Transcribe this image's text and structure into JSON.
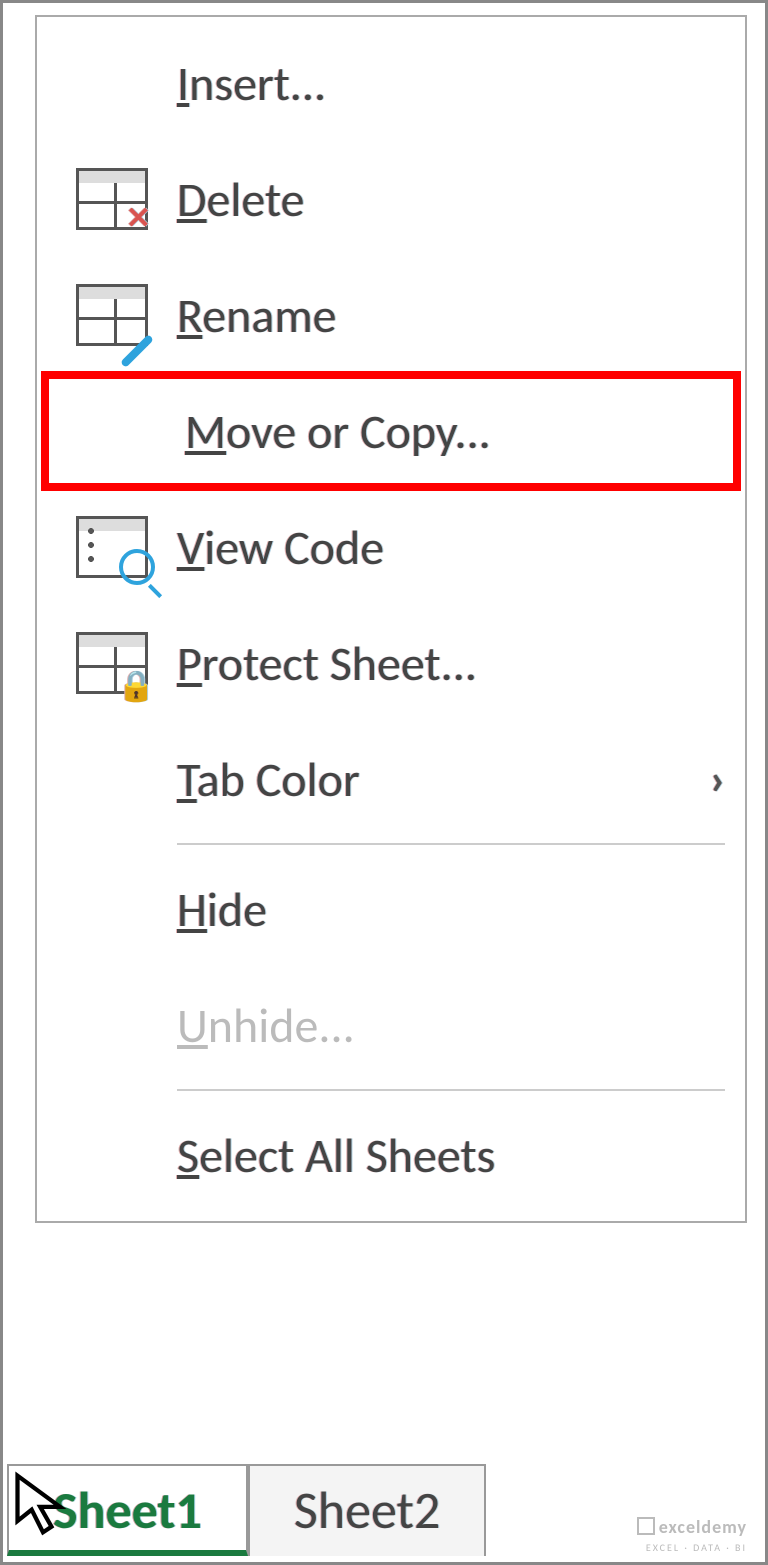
{
  "menu": {
    "insert": {
      "accel": "I",
      "rest": "nsert..."
    },
    "delete": {
      "accel": "D",
      "rest": "elete"
    },
    "rename": {
      "accel": "R",
      "rest": "ename"
    },
    "move": {
      "accel": "M",
      "rest": "ove or Copy..."
    },
    "viewcode": {
      "accel": "V",
      "rest": "iew Code"
    },
    "protect": {
      "accel": "P",
      "rest": "rotect Sheet..."
    },
    "tabcolor": {
      "accel": "T",
      "rest": "ab Color"
    },
    "hide": {
      "accel": "H",
      "rest": "ide"
    },
    "unhide": {
      "accel": "U",
      "rest": "nhide..."
    },
    "selectall": {
      "accel": "S",
      "rest": "elect All Sheets"
    }
  },
  "tabs": {
    "active": "Sheet1",
    "inactive": "Sheet2"
  },
  "arrow_glyph": "›",
  "watermark": {
    "brand": "exceldemy",
    "tag": "EXCEL · DATA · BI"
  }
}
